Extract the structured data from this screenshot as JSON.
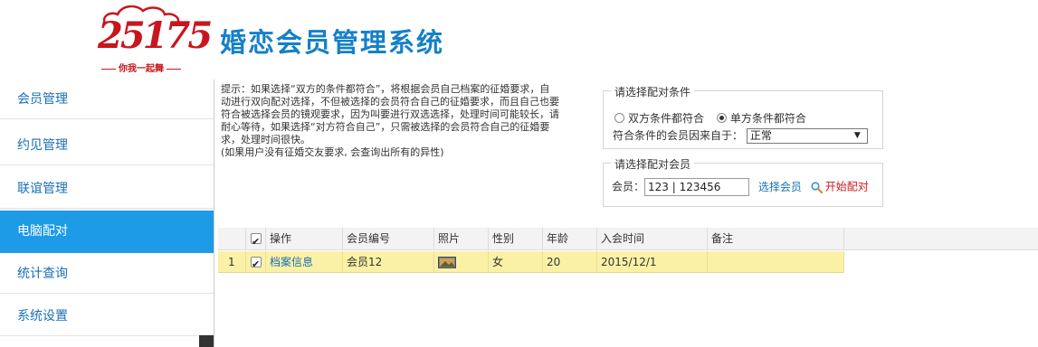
{
  "logo": {
    "number": "25175",
    "tagline": "你我一起舞"
  },
  "app": {
    "title": "婚恋会员管理系统"
  },
  "sidebar": {
    "items": [
      {
        "label": "会员管理",
        "active": false
      },
      {
        "label": "约见管理",
        "active": false
      },
      {
        "label": "联谊管理",
        "active": false
      },
      {
        "label": "电脑配对",
        "active": true
      },
      {
        "label": "统计查询",
        "active": false
      },
      {
        "label": "系统设置",
        "active": false
      }
    ]
  },
  "tip": {
    "lines": [
      "提示：如果选择“双方的条件都符合”，将根据会员自己档案的征婚要求，自",
      "动进行双向配对选择，不但被选择的会员符合自己的征婚要求，而且自己也要",
      "符合被选择会员的镜观要求，因为叫要进行双选选择，处理时间可能较长，请",
      "耐心等待，如果选择“对方符合自己”，只需被选择的会员符合自己的征婚要",
      "求，处理时间很快。"
    ],
    "note": "(如果用户没有征婚交友要求, 会查询出所有的异性)"
  },
  "condition": {
    "legend": "请选择配对条件",
    "option_both": "双方条件都符合",
    "option_single": "单方条件都符合",
    "selected": "single",
    "from_label": "符合条件的会员因来自于：",
    "from_value": "正常"
  },
  "member": {
    "legend": "请选择配对会员",
    "label": "会员：",
    "value": "123 | 123456",
    "select_link": "选择会员",
    "start_link": "开始配对"
  },
  "table": {
    "columns": [
      "操作",
      "会员编号",
      "照片",
      "性别",
      "年龄",
      "入会时间",
      "备注"
    ],
    "header_checked": true,
    "rows": [
      {
        "index": "1",
        "checked": true,
        "action": "档案信息",
        "member_no": "会员12",
        "gender": "女",
        "age": "20",
        "join_date": "2015/12/1",
        "note": ""
      }
    ]
  },
  "colors": {
    "brand_blue": "#1580c8",
    "active_nav": "#1e9be6",
    "logo_red": "#c8161d",
    "row_highlight": "#fbf1a6"
  }
}
